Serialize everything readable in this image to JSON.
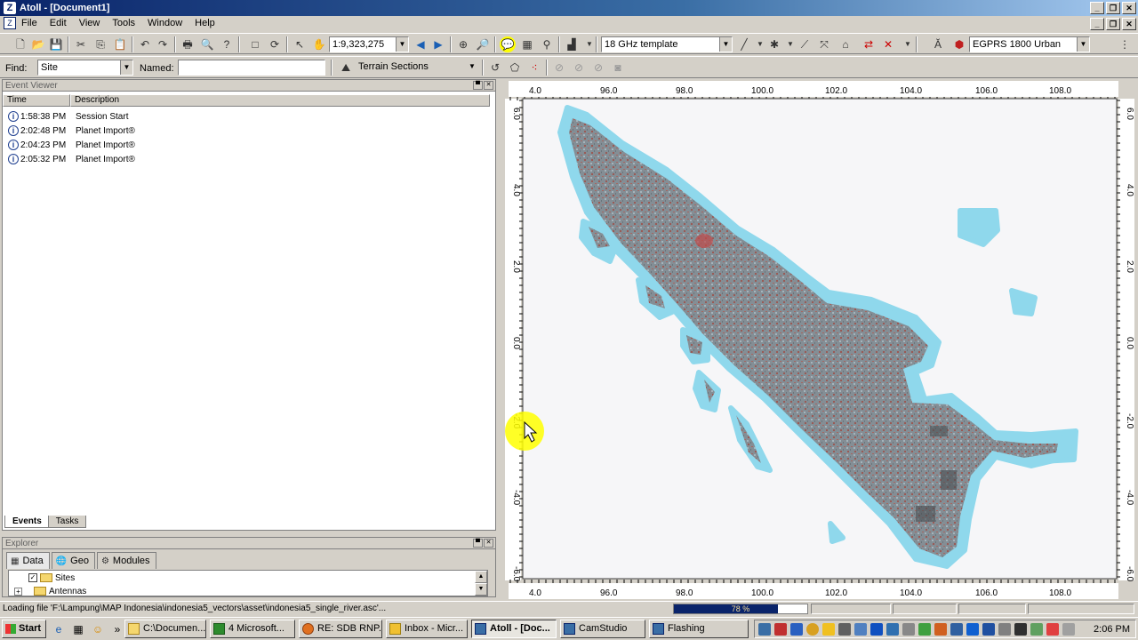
{
  "window": {
    "title": "Atoll - [Document1]"
  },
  "menu": [
    "File",
    "Edit",
    "View",
    "Tools",
    "Window",
    "Help"
  ],
  "toolbar1": {
    "scale": "1:9,323,275",
    "template": "18 GHz template",
    "service": "EGPRS 1800 Urban"
  },
  "toolbar2": {
    "find_label": "Find:",
    "find_value": "Site",
    "named_label": "Named:",
    "named_value": "",
    "terrain": "Terrain Sections"
  },
  "event_viewer": {
    "title": "Event Viewer",
    "columns": [
      "Time",
      "Description"
    ],
    "rows": [
      {
        "time": "1:58:38 PM",
        "description": "Session Start"
      },
      {
        "time": "2:02:48 PM",
        "description": "Planet Import®"
      },
      {
        "time": "2:04:23 PM",
        "description": "Planet Import®"
      },
      {
        "time": "2:05:32 PM",
        "description": "Planet Import®"
      }
    ],
    "tabs": [
      "Events",
      "Tasks"
    ]
  },
  "explorer": {
    "title": "Explorer",
    "tabs": [
      "Data",
      "Geo",
      "Modules"
    ],
    "tree": [
      "Sites",
      "Antennas"
    ]
  },
  "map": {
    "x_ticks": [
      "4.0",
      "96.0",
      "98.0",
      "100.0",
      "102.0",
      "104.0",
      "106.0",
      "108.0"
    ],
    "y_ticks": [
      "6.0",
      "4.0",
      "2.0",
      "0.0",
      "-2.0",
      "-4.0",
      "-6.0"
    ],
    "colors": {
      "sea": "#8fd8ec",
      "land": "#7e8a92",
      "urban": "#9b5b55",
      "highland": "#c04848"
    }
  },
  "status": {
    "text": "Loading file 'F:\\Lampung\\MAP Indonesia\\indonesia5_vectors\\asset\\indonesia5_single_river.asc'...",
    "progress_label": "78 %",
    "progress": 0.78
  },
  "taskbar": {
    "start": "Start",
    "tasks": [
      "C:\\Documen...",
      "4 Microsoft...",
      "RE: SDB RNP...",
      "Inbox - Micr...",
      "Atoll - [Doc...",
      "CamStudio",
      "Flashing"
    ],
    "active_task": "Atoll - [Doc...",
    "overflow": "»",
    "clock": "2:06 PM"
  }
}
